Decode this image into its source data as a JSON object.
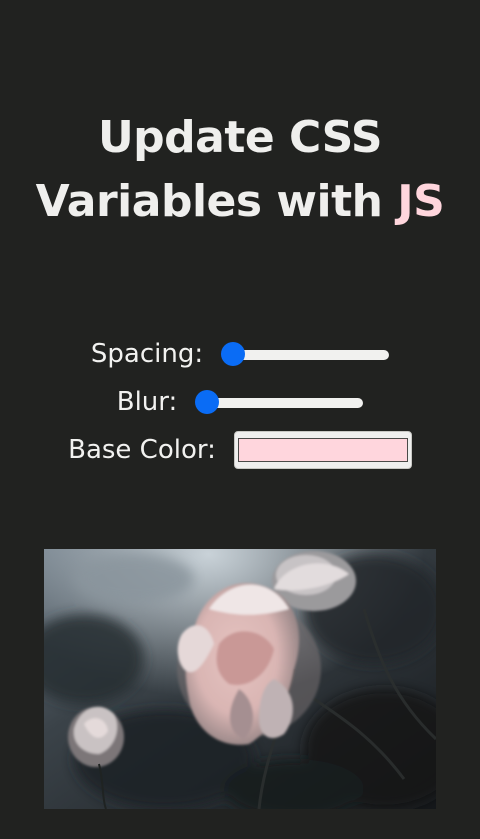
{
  "title": {
    "line1": "Update CSS",
    "line2_prefix": "Variables with",
    "line2_accent": "JS"
  },
  "controls": {
    "spacing": {
      "label": "Spacing:",
      "value_fraction": 0.0
    },
    "blur": {
      "label": "Blur:",
      "value_fraction": 0.0
    },
    "base_color": {
      "label": "Base Color:",
      "value": "#ffd6dd"
    }
  },
  "colors": {
    "background": "#212220",
    "text": "#efefed",
    "accent": "#ffd6dd",
    "slider_thumb": "#0a6cf5",
    "slider_track": "#f1f1ef"
  },
  "image": {
    "subject": "pale pink roses at dusk"
  }
}
